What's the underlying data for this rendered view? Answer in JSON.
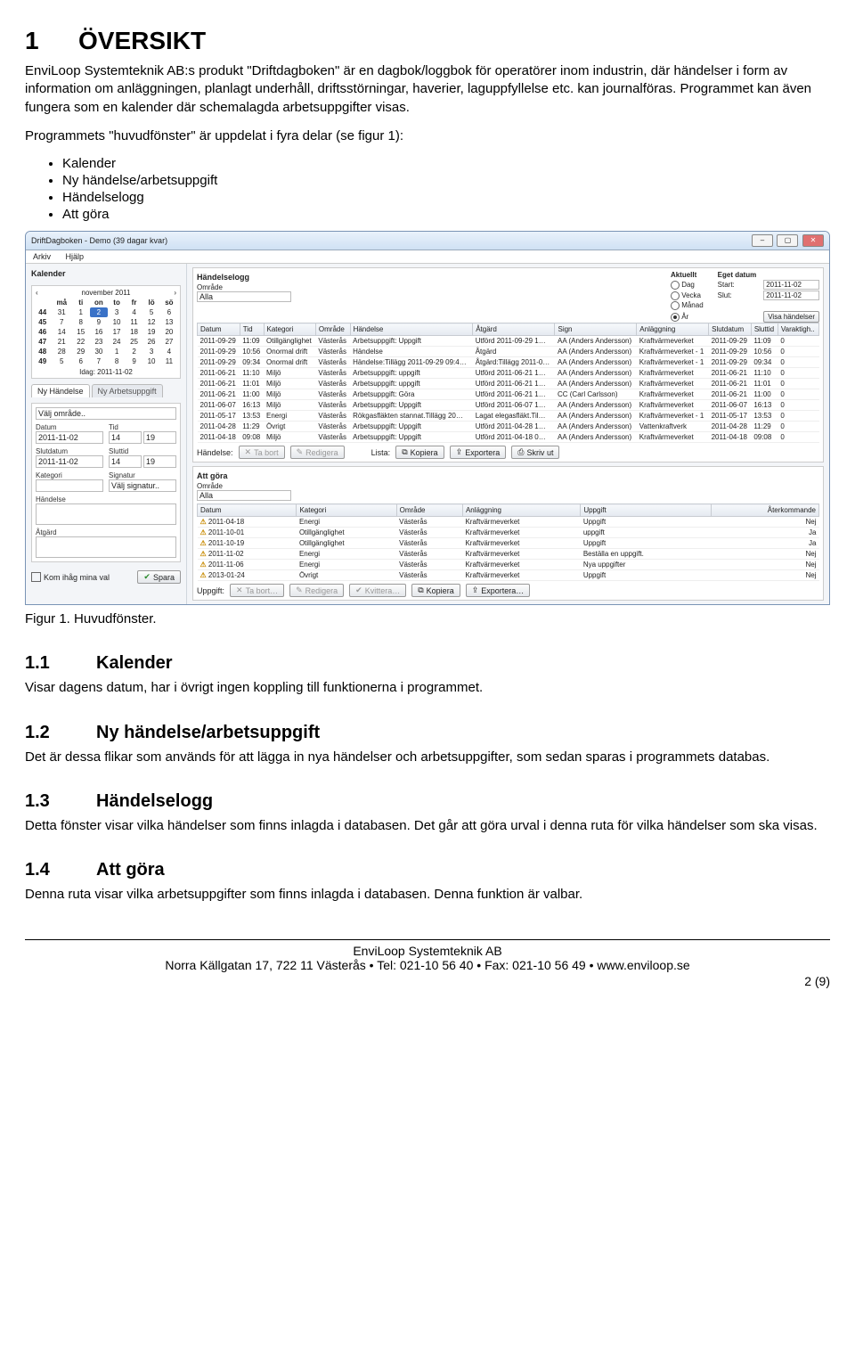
{
  "section": {
    "num": "1",
    "title": "ÖVERSIKT"
  },
  "intro1": "EnviLoop Systemteknik AB:s produkt \"Driftdagboken\" är en dagbok/loggbok för operatörer inom industrin, där händelser i form av information om anläggningen, planlagt underhåll, driftsstörningar, haverier, laguppfyllelse etc. kan journalföras. Programmet kan även fungera som en kalender där schemalagda arbetsuppgifter visas.",
  "intro2": "Programmets \"huvudfönster\" är uppdelat i fyra delar (se figur 1):",
  "bullets": [
    "Kalender",
    "Ny händelse/arbetsuppgift",
    "Händelselogg",
    "Att göra"
  ],
  "figcap": "Figur 1. Huvudfönster.",
  "s11": {
    "num": "1.1",
    "title": "Kalender",
    "body": "Visar dagens datum, har i övrigt ingen koppling till funktionerna i programmet."
  },
  "s12": {
    "num": "1.2",
    "title": "Ny händelse/arbetsuppgift",
    "body": "Det är dessa flikar som används för att lägga in nya händelser och arbetsuppgifter, som sedan sparas i programmets databas."
  },
  "s13": {
    "num": "1.3",
    "title": "Händelselogg",
    "body": "Detta fönster visar vilka händelser som finns inlagda i databasen. Det går att göra urval i denna ruta för vilka händelser som ska visas."
  },
  "s14": {
    "num": "1.4",
    "title": "Att göra",
    "body": "Denna ruta visar vilka arbetsuppgifter som finns inlagda i databasen. Denna funktion är valbar."
  },
  "footer": {
    "company": "EnviLoop Systemteknik AB",
    "line2": "Norra Källgatan 17, 722 11 Västerås • Tel: 021-10 56 40 • Fax: 021-10 56 49 • www.enviloop.se",
    "page": "2 (9)"
  },
  "app": {
    "title": "DriftDagboken - Demo (39 dagar kvar)",
    "menu": [
      "Arkiv",
      "Hjälp"
    ],
    "kalender": {
      "label": "Kalender",
      "month": "november 2011",
      "dow": [
        "må",
        "ti",
        "on",
        "to",
        "fr",
        "lö",
        "sö"
      ],
      "weeks": [
        [
          "44",
          "31",
          "1",
          "2",
          "3",
          "4",
          "5",
          "6"
        ],
        [
          "45",
          "7",
          "8",
          "9",
          "10",
          "11",
          "12",
          "13"
        ],
        [
          "46",
          "14",
          "15",
          "16",
          "17",
          "18",
          "19",
          "20"
        ],
        [
          "47",
          "21",
          "22",
          "23",
          "24",
          "25",
          "26",
          "27"
        ],
        [
          "48",
          "28",
          "29",
          "30",
          "1",
          "2",
          "3",
          "4"
        ],
        [
          "49",
          "5",
          "6",
          "7",
          "8",
          "9",
          "10",
          "11"
        ]
      ],
      "today": "Idag: 2011-11-02"
    },
    "tabs": {
      "t1": "Ny Händelse",
      "t2": "Ny Arbetsuppgift"
    },
    "form": {
      "valj": "Välj område..",
      "datum": "Datum",
      "tid": "Tid",
      "slutdatum": "Slutdatum",
      "sluttid": "Sluttid",
      "kategori": "Kategori",
      "signatur": "Signatur",
      "valjsig": "Välj signatur..",
      "handelse": "Händelse",
      "atgard": "Åtgärd",
      "d1": "2011-11-02",
      "t1": "14",
      "t1m": "19",
      "d2": "2011-11-02",
      "t2": "14",
      "t2m": "19",
      "kom": "Kom ihåg mina val",
      "spara": "Spara"
    },
    "hl": {
      "title": "Händelselogg",
      "omrade": "Område",
      "alla": "Alla",
      "aktuellt": "Aktuellt",
      "dag": "Dag",
      "vecka": "Vecka",
      "manad": "Månad",
      "ar": "År",
      "eget": "Eget datum",
      "start": "Start:",
      "slut": "Slut:",
      "sd": "2011-11-02",
      "sl": "2011-11-02",
      "visa": "Visa händelser",
      "cols": [
        "Datum",
        "Tid",
        "Kategori",
        "Område",
        "Händelse",
        "Åtgärd",
        "Sign",
        "Anläggning",
        "Slutdatum",
        "Sluttid",
        "Varaktigh.."
      ],
      "rows": [
        [
          "2011-09-29",
          "11:09",
          "Otillgänglighet",
          "Västerås",
          "Arbetsuppgift: Uppgift",
          "Utförd 2011-09-29 1…",
          "AA (Anders Andersson)",
          "Kraftvärmeverket",
          "2011-09-29",
          "11:09",
          "0"
        ],
        [
          "2011-09-29",
          "10:56",
          "Onormal drift",
          "Västerås",
          "Händelse",
          "Åtgärd",
          "AA (Anders Andersson)",
          "Kraftvärmeverket - 1",
          "2011-09-29",
          "10:56",
          "0"
        ],
        [
          "2011-09-29",
          "09:34",
          "Onormal drift",
          "Västerås",
          "Händelse:Tillägg 2011-09-29 09:4…",
          "Åtgärd:Tillägg 2011-0…",
          "AA (Anders Andersson)",
          "Kraftvärmeverket - 1",
          "2011-09-29",
          "09:34",
          "0"
        ],
        [
          "2011-06-21",
          "11:10",
          "Miljö",
          "Västerås",
          "Arbetsuppgift: uppgift",
          "Utförd 2011-06-21 1…",
          "AA (Anders Andersson)",
          "Kraftvärmeverket",
          "2011-06-21",
          "11:10",
          "0"
        ],
        [
          "2011-06-21",
          "11:01",
          "Miljö",
          "Västerås",
          "Arbetsuppgift: uppgift",
          "Utförd 2011-06-21 1…",
          "AA (Anders Andersson)",
          "Kraftvärmeverket",
          "2011-06-21",
          "11:01",
          "0"
        ],
        [
          "2011-06-21",
          "11:00",
          "Miljö",
          "Västerås",
          "Arbetsuppgift: Göra",
          "Utförd 2011-06-21 1…",
          "CC (Carl Carlsson)",
          "Kraftvärmeverket",
          "2011-06-21",
          "11:00",
          "0"
        ],
        [
          "2011-06-07",
          "16:13",
          "Miljö",
          "Västerås",
          "Arbetsuppgift: Uppgift",
          "Utförd 2011-06-07 1…",
          "AA (Anders Andersson)",
          "Kraftvärmeverket",
          "2011-06-07",
          "16:13",
          "0"
        ],
        [
          "2011-05-17",
          "13:53",
          "Energi",
          "Västerås",
          "Rökgasfläkten stannat.Tillägg 20…",
          "Lagat elegasfläkt.Til…",
          "AA (Anders Andersson)",
          "Kraftvärmeverket - 1",
          "2011-05-17",
          "13:53",
          "0"
        ],
        [
          "2011-04-28",
          "11:29",
          "Övrigt",
          "Västerås",
          "Arbetsuppgift: Uppgift",
          "Utförd 2011-04-28 1…",
          "AA (Anders Andersson)",
          "Vattenkraftverk",
          "2011-04-28",
          "11:29",
          "0"
        ],
        [
          "2011-04-18",
          "09:08",
          "Miljö",
          "Västerås",
          "Arbetsuppgift: Uppgift",
          "Utförd 2011-04-18 0…",
          "AA (Anders Andersson)",
          "Kraftvärmeverket",
          "2011-04-18",
          "09:08",
          "0"
        ]
      ],
      "btns": {
        "handelse": "Händelse:",
        "tabort": "Ta bort",
        "redigera": "Redigera",
        "lista": "Lista:",
        "kopiera": "Kopiera",
        "exportera": "Exportera",
        "skrivut": "Skriv ut"
      }
    },
    "ag": {
      "title": "Att göra",
      "omrade": "Område",
      "alla": "Alla",
      "cols": [
        "Datum",
        "Kategori",
        "Område",
        "Anläggning",
        "Uppgift",
        "Återkommande"
      ],
      "rows": [
        [
          "2011-04-18",
          "Energi",
          "Västerås",
          "Kraftvärmeverket",
          "Uppgift",
          "Nej"
        ],
        [
          "2011-10-01",
          "Otillgänglighet",
          "Västerås",
          "Kraftvärmeverket",
          "uppgift",
          "Ja"
        ],
        [
          "2011-10-19",
          "Otillgänglighet",
          "Västerås",
          "Kraftvärmeverket",
          "Uppgift",
          "Ja"
        ],
        [
          "2011-11-02",
          "Energi",
          "Västerås",
          "Kraftvärmeverket",
          "Beställa en uppgift.",
          "Nej"
        ],
        [
          "2011-11-06",
          "Energi",
          "Västerås",
          "Kraftvärmeverket",
          "Nya uppgifter",
          "Nej"
        ],
        [
          "2013-01-24",
          "Övrigt",
          "Västerås",
          "Kraftvärmeverket",
          "Uppgift",
          "Nej"
        ]
      ],
      "btns": {
        "uppgift": "Uppgift:",
        "tabort": "Ta bort…",
        "redigera": "Redigera",
        "kvittera": "Kvittera…",
        "kopiera": "Kopiera",
        "exportera": "Exportera…"
      }
    }
  }
}
